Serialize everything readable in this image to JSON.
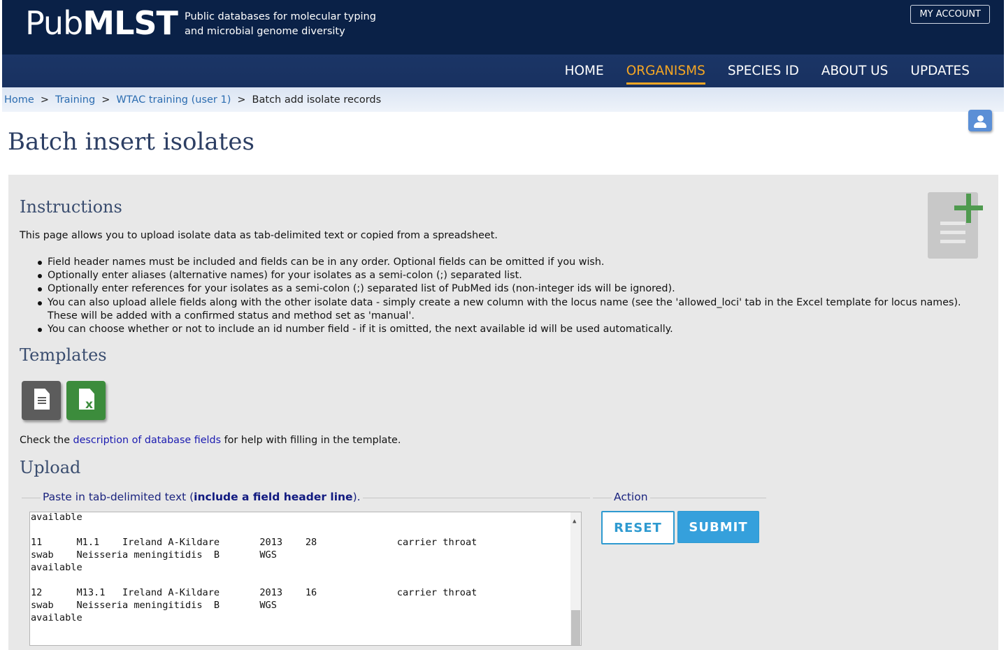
{
  "header": {
    "logo_light": "Pub",
    "logo_bold": "MLST",
    "tagline_line1": "Public databases for molecular typing",
    "tagline_line2": "and microbial genome diversity",
    "my_account": "MY ACCOUNT"
  },
  "nav": {
    "items": [
      "HOME",
      "ORGANISMS",
      "SPECIES ID",
      "ABOUT US",
      "UPDATES"
    ],
    "active": "ORGANISMS"
  },
  "breadcrumb": {
    "items": [
      "Home",
      "Training",
      "WTAC training (user 1)",
      "Batch add isolate records"
    ],
    "separator": ">"
  },
  "page_title": "Batch insert isolates",
  "instructions": {
    "heading": "Instructions",
    "intro": "This page allows you to upload isolate data as tab-delimited text or copied from a spreadsheet.",
    "bullets": [
      "Field header names must be included and fields can be in any order. Optional fields can be omitted if you wish.",
      "Optionally enter aliases (alternative names) for your isolates as a semi-colon (;) separated list.",
      "Optionally enter references for your isolates as a semi-colon (;) separated list of PubMed ids (non-integer ids will be ignored).",
      "You can also upload allele fields along with the other isolate data - simply create a new column with the locus name (see the 'allowed_loci' tab in the Excel template for locus names). These will be added with a confirmed status and method set as 'manual'.",
      "You can choose whether or not to include an id number field - if it is omitted, the next available id will be used automatically."
    ]
  },
  "templates": {
    "heading": "Templates",
    "help_prefix": "Check the ",
    "help_link": "description of database fields",
    "help_suffix": " for help with filling in the template."
  },
  "upload": {
    "heading": "Upload",
    "paste_legend_prefix": "Paste in tab-delimited text (",
    "paste_legend_bold": "include a field header line",
    "paste_legend_suffix": ").",
    "textarea_value": "available\n\n11      M1.1    Ireland A-Kildare       2013    28              carrier throat\nswab    Neisseria meningitidis  B       WGS\navailable\n\n12      M13.1   Ireland A-Kildare       2013    16              carrier throat\nswab    Neisseria meningitidis  B       WGS\navailable",
    "action_legend": "Action",
    "reset_label": "RESET",
    "submit_label": "SUBMIT"
  },
  "colors": {
    "header_bg": "#0a2147",
    "nav_active": "#f5a623",
    "link": "#2b6cb0",
    "button_blue": "#35a0dc"
  }
}
